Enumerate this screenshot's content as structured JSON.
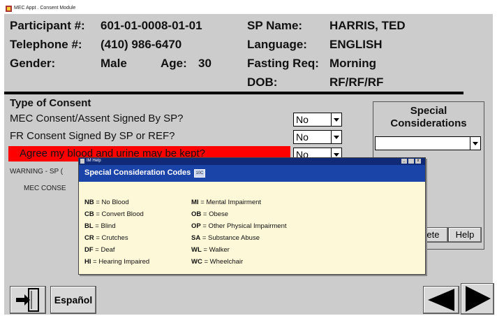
{
  "window": {
    "title": "MEC Appt . Consent Module"
  },
  "participant": {
    "participant_label": "Participant #:",
    "participant_value": "601-01-0008-01-01",
    "telephone_label": "Telephone #:",
    "telephone_value": "(410) 986-6470",
    "gender_label": "Gender:",
    "gender_value": "Male",
    "age_label": "Age:",
    "age_value": "30",
    "sp_name_label": "SP Name:",
    "sp_name_value": "HARRIS, TED",
    "language_label": "Language:",
    "language_value": "ENGLISH",
    "fasting_label": "Fasting Req:",
    "fasting_value": "Morning",
    "dob_label": "DOB:",
    "dob_value": "RF/RF/RF"
  },
  "consent": {
    "section_title": "Type of Consent",
    "q1": "MEC Consent/Assent Signed By SP?",
    "q1_value": "No",
    "q2": "FR Consent Signed By SP or REF?",
    "q2_value": "No",
    "q3": "Agree my blood and urine may be kept?",
    "q3_value": "No",
    "warning": "WARNING - SP (",
    "mec_conse": "MEC CONSE"
  },
  "special": {
    "title_line1": "Special",
    "title_line2": "Considerations",
    "select_value": "",
    "delete_label": "lete",
    "help_label": "Help"
  },
  "dialog": {
    "window_title": "IM Help",
    "header": "Special Consideration Codes",
    "badge": "10C",
    "codes_left": [
      {
        "code": "NB",
        "desc": " = No Blood"
      },
      {
        "code": "CB",
        "desc": " = Convert Blood"
      },
      {
        "code": "BL",
        "desc": " = Blind"
      },
      {
        "code": "CR",
        "desc": " = Crutches"
      },
      {
        "code": "DF",
        "desc": " = Deaf"
      },
      {
        "code": "HI",
        "desc": " = Hearing Impaired"
      }
    ],
    "codes_right": [
      {
        "code": "MI",
        "desc": " = Mental Impairment"
      },
      {
        "code": "OB",
        "desc": " = Obese"
      },
      {
        "code": "OP",
        "desc": " = Other Physical Impairment"
      },
      {
        "code": "SA",
        "desc": " = Substance Abuse"
      },
      {
        "code": "WL",
        "desc": " = Walker"
      },
      {
        "code": "WC",
        "desc": " = Wheelchair"
      }
    ]
  },
  "footer": {
    "espanol_label": "Español"
  },
  "colors": {
    "app_bg": "#cccccc",
    "red_highlight": "#ff0000",
    "dialog_bg": "#fdf8d8",
    "dialog_header": "#1a44a8"
  },
  "icons": [
    "exit-door-icon",
    "back-arrow-icon",
    "forward-arrow-icon"
  ]
}
